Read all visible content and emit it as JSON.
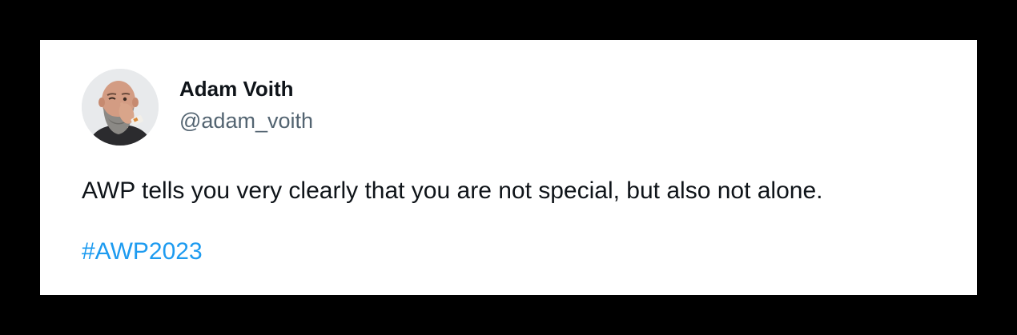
{
  "tweet": {
    "author": {
      "display_name": "Adam Voith",
      "handle": "@adam_voith",
      "avatar_icon": "profile-photo"
    },
    "text": "AWP tells you very clearly that you are not special, but also not alone.",
    "hashtag": "#AWP2023"
  },
  "colors": {
    "page_background": "#000000",
    "card_background": "#ffffff",
    "text_primary": "#0f1419",
    "text_secondary": "#536471",
    "link": "#1d9bf0"
  }
}
